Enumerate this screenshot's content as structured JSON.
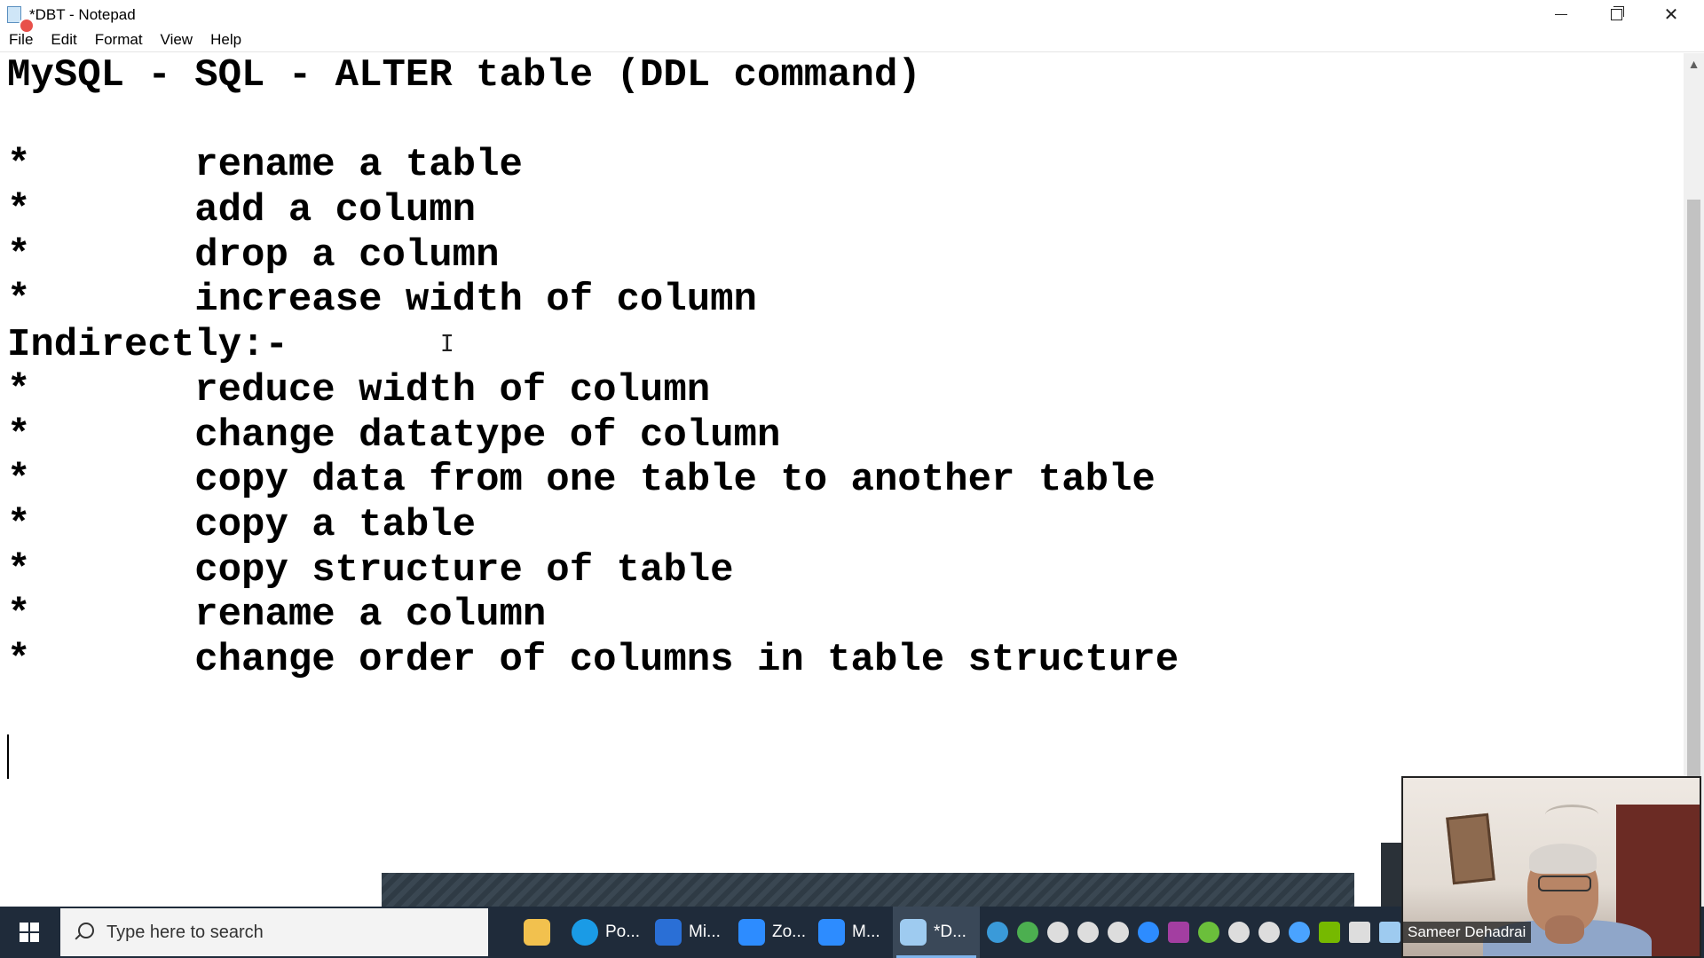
{
  "window": {
    "title": "*DBT - Notepad",
    "minimize_glyph": "",
    "close_glyph": "✕"
  },
  "menu": [
    "File",
    "Edit",
    "Format",
    "View",
    "Help"
  ],
  "editor": {
    "lines": [
      "MySQL - SQL - ALTER table (DDL command)",
      "",
      "*       rename a table",
      "*       add a column",
      "*       drop a column",
      "*       increase width of column",
      "Indirectly:-",
      "*       reduce width of column",
      "*       change datatype of column",
      "*       copy data from one table to another table",
      "*       copy a table",
      "*       copy structure of table",
      "*       rename a column",
      "*       change order of columns in table structure"
    ]
  },
  "webcam": {
    "participant_name": "Sameer Dehadrai"
  },
  "taskbar": {
    "search_placeholder": "Type here to search",
    "apps": [
      {
        "name": "file-explorer",
        "label": "",
        "color": "#f2c14e"
      },
      {
        "name": "edge",
        "label": "Po...",
        "color": "#1a9be6"
      },
      {
        "name": "whiteboard",
        "label": "Mi...",
        "color": "#2a6fd6"
      },
      {
        "name": "zoom-1",
        "label": "Zo...",
        "color": "#2d8cff"
      },
      {
        "name": "zoom-2",
        "label": "M...",
        "color": "#2d8cff"
      },
      {
        "name": "notepad",
        "label": "*D...",
        "color": "#9ecbf0"
      }
    ],
    "tray_colors": [
      "#3a9ad9",
      "#4caf50",
      "#dddddd",
      "#dddddd",
      "#dddddd",
      "#2d8cff",
      "#a33ea1",
      "#6bbf3b",
      "#dddddd",
      "#dddddd",
      "#4aa3ff",
      "#76b900",
      "#dddddd",
      "#9ecbf0"
    ]
  }
}
